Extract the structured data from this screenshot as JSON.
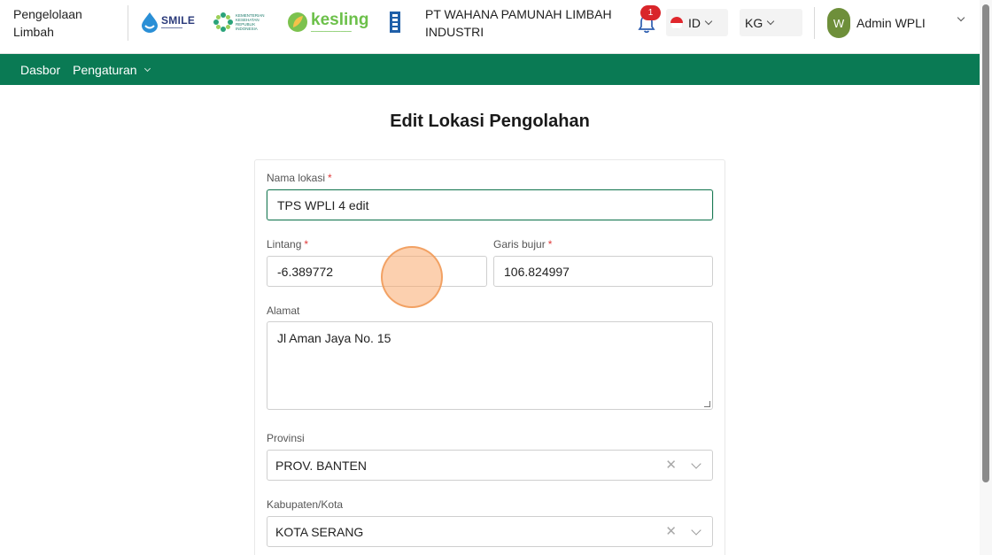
{
  "header": {
    "app_title": "Pengelolaan Limbah",
    "logos": {
      "smile": "SMILE",
      "kemenkes": "KEMENTERIAN KESEHATAN REPUBLIK INDONESIA",
      "kesling": "kesling"
    },
    "company": "PT WAHANA PAMUNAH LIMBAH INDUSTRI",
    "notifications_count": "1",
    "language": "ID",
    "unit": "KG",
    "user_initial": "W",
    "user_name": "Admin WPLI"
  },
  "nav": {
    "items": [
      {
        "label": "Dasbor"
      },
      {
        "label": "Pengaturan"
      }
    ]
  },
  "page": {
    "title": "Edit Lokasi Pengolahan"
  },
  "form": {
    "nama_lokasi": {
      "label": "Nama lokasi",
      "required": "*",
      "value": "TPS WPLI 4 edit"
    },
    "lintang": {
      "label": "Lintang",
      "required": "*",
      "value": "-6.389772"
    },
    "garis_bujur": {
      "label": "Garis bujur",
      "required": "*",
      "value": "106.824997"
    },
    "alamat": {
      "label": "Alamat",
      "value": "Jl Aman Jaya No. 15"
    },
    "provinsi": {
      "label": "Provinsi",
      "value": "PROV. BANTEN"
    },
    "kabupaten": {
      "label": "Kabupaten/Kota",
      "value": "KOTA SERANG"
    }
  },
  "colors": {
    "nav_bg": "#0a7a54",
    "focus_border": "#1b7a55",
    "required": "#e03a3a",
    "badge": "#d9252a"
  }
}
